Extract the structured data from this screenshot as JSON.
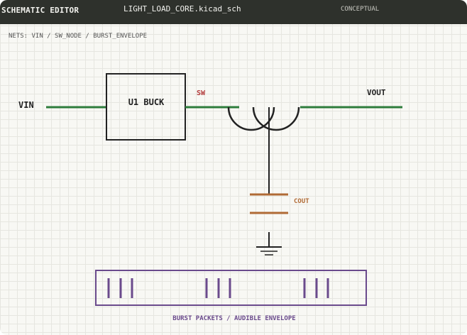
{
  "titlebar": {
    "app_name": "SCHEMATIC EDITOR",
    "file_name": "LIGHT_LOAD_CORE.kicad_sch",
    "mode": "CONCEPTUAL"
  },
  "nets_label": "NETS: VIN / SW_NODE / BURST_ENVELOPE",
  "schematic": {
    "vin_label": "VIN",
    "buck_label": "U1 BUCK",
    "sw_label": "SW",
    "vout_label": "VOUT",
    "cout_label": "COUT",
    "burst_label": "BURST PACKETS / AUDIBLE ENVELOPE"
  },
  "colors": {
    "wire": "#2e7d3c",
    "outline": "#222222",
    "sw": "#b23a3a",
    "cap": "#b06a35",
    "burst": "#6a4a8c"
  }
}
